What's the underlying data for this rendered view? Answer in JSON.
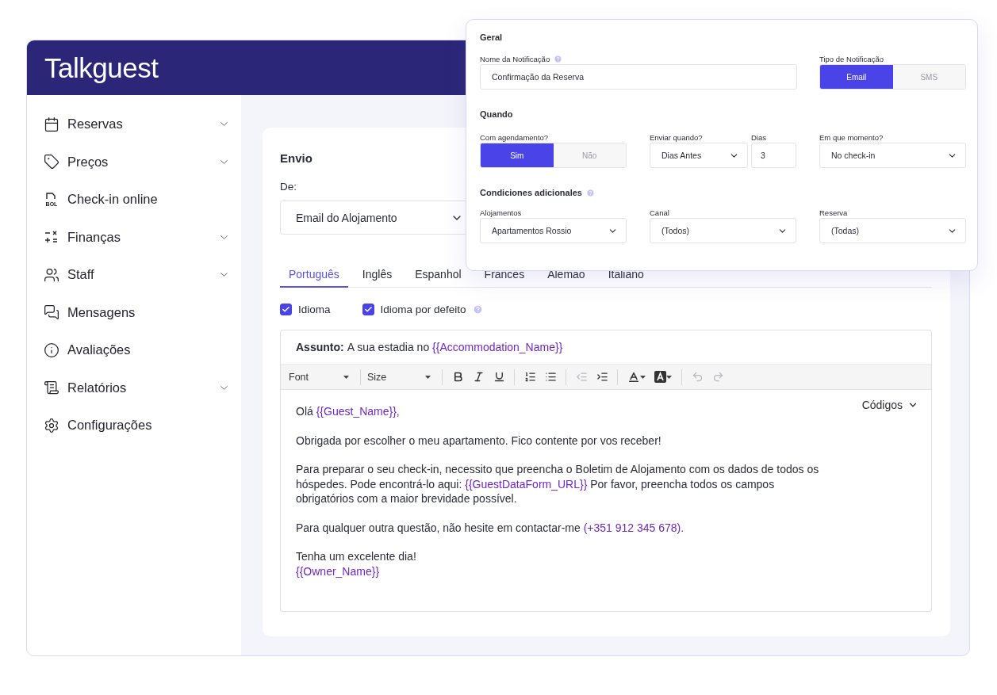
{
  "app": {
    "logo": "Talkguest"
  },
  "sidebar": {
    "items": [
      {
        "label": "Reservas",
        "kind": "group"
      },
      {
        "label": "Preços",
        "kind": "group"
      },
      {
        "label": "Check-in online",
        "kind": "link",
        "icon_text": "BOL"
      },
      {
        "label": "Finanças",
        "kind": "group"
      },
      {
        "label": "Staff",
        "kind": "group"
      },
      {
        "label": "Mensagens",
        "kind": "link"
      },
      {
        "label": "Avaliações",
        "kind": "link"
      },
      {
        "label": "Relatórios",
        "kind": "group"
      },
      {
        "label": "Configurações",
        "kind": "link"
      }
    ]
  },
  "envio": {
    "title": "Envio",
    "from_label": "De:",
    "from_value": "Email do Alojamento",
    "tabs": [
      {
        "label": "Português",
        "selected": true
      },
      {
        "label": "Inglês",
        "selected": false
      },
      {
        "label": "Espanhol",
        "selected": false
      },
      {
        "label": "Frances",
        "selected": false
      },
      {
        "label": "Alemao",
        "selected": false
      },
      {
        "label": "Italiano",
        "selected": false
      }
    ],
    "checkboxes": [
      {
        "label": "Idioma",
        "checked": true,
        "help": false
      },
      {
        "label": "Idioma por defeito",
        "checked": true,
        "help": true
      }
    ],
    "editor": {
      "subject_label": "Assunto:",
      "subject": [
        {
          "kind": "plain",
          "text": "A sua estadia no"
        },
        {
          "kind": "code",
          "text": "{{Accommodation_Name}}"
        }
      ],
      "toolbar": {
        "font": "Font",
        "size": "Size"
      },
      "codes_label": "Códigos",
      "paragraphs": [
        [
          {
            "kind": "plain",
            "text": "Olá"
          },
          {
            "kind": "code",
            "text": "{{Guest_Name}},"
          }
        ],
        [
          {
            "kind": "plain",
            "text": "Obrigada por escolher o meu apartamento. Fico contente por vos receber!"
          }
        ],
        [
          {
            "kind": "plain",
            "text": "Para preparar o seu check-in, necessito que preencha o Boletim de Alojamento com os dados de todos os hóspedes. Pode encontrá-lo aqui:"
          },
          {
            "kind": "code",
            "text": "{{GuestDataForm_URL}}"
          },
          {
            "kind": "plain",
            "text": "Por favor, preencha todos os campos obrigatórios com a maior brevidade possível."
          }
        ],
        [
          {
            "kind": "plain",
            "text": "Para qualquer outra questão, não hesite em contactar-me "
          },
          {
            "kind": "code",
            "text": "(+351 912 345 678)."
          }
        ],
        [
          {
            "kind": "plain",
            "text": "Tenha um excelente dia!"
          },
          {
            "kind": "break"
          },
          {
            "kind": "code",
            "text": "{{Owner_Name}}"
          }
        ]
      ]
    }
  },
  "notification": {
    "geral": {
      "title": "Geral",
      "name_label": "Nome da Notificação",
      "name_value": "Confirmação da Reserva",
      "type_label": "Tipo de Notificação",
      "type_options": [
        {
          "label": "Email",
          "selected": true
        },
        {
          "label": "SMS",
          "selected": false
        }
      ]
    },
    "quando": {
      "title": "Quando",
      "schedule_label": "Com agendamento?",
      "schedule_options": [
        {
          "label": "Sim",
          "selected": true
        },
        {
          "label": "Não",
          "selected": false
        }
      ],
      "send_label": "Enviar quando?",
      "send_value": "Dias Antes",
      "days_label": "Dias",
      "days_value": "3",
      "moment_label": "Em que momento?",
      "moment_value": "No check-in"
    },
    "conditions": {
      "title": "Condiciones adicionales",
      "fields": [
        {
          "label": "Alojamentos",
          "value": "Apartamentos Rossio"
        },
        {
          "label": "Canal",
          "value": "(Todos)"
        },
        {
          "label": "Reserva",
          "value": "(Todas)"
        }
      ]
    }
  }
}
